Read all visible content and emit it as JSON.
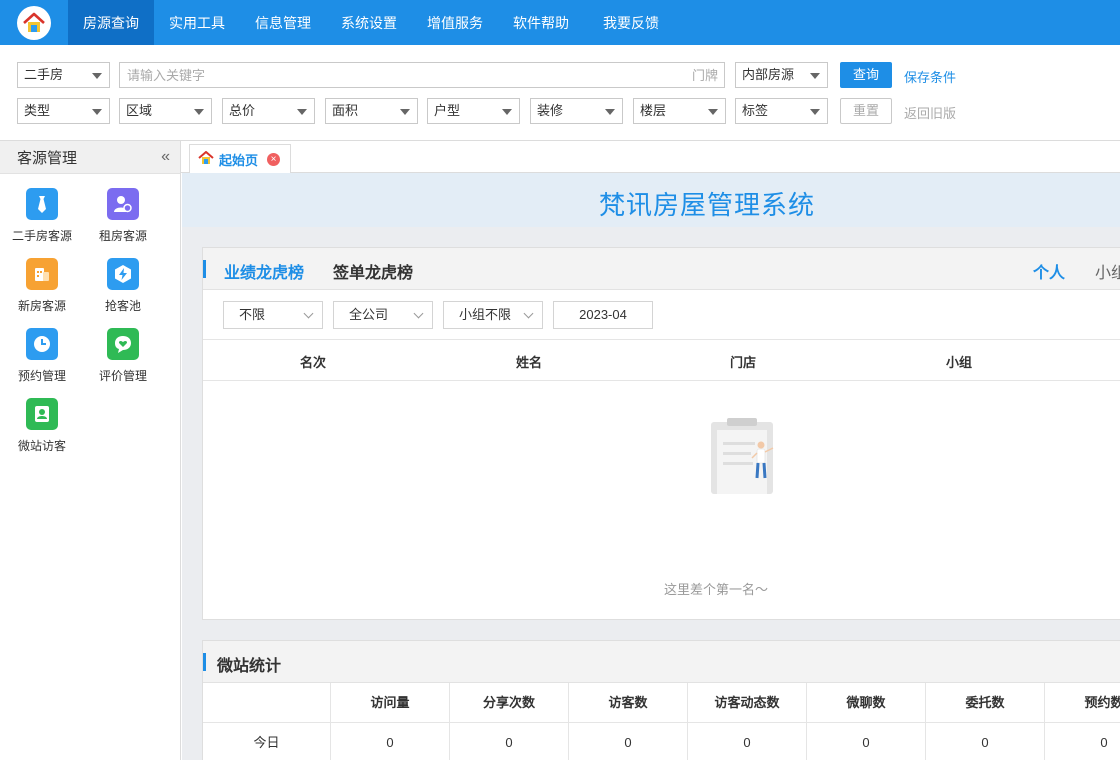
{
  "nav": {
    "items": [
      "房源查询",
      "实用工具",
      "信息管理",
      "系统设置",
      "增值服务",
      "软件帮助",
      "我要反馈"
    ],
    "active_index": 0
  },
  "search": {
    "type_value": "二手房",
    "keyword_placeholder": "请输入关键字",
    "door_placeholder": "门牌",
    "scope_value": "内部房源",
    "query_label": "查询",
    "save_label": "保存条件",
    "reset_label": "重置",
    "old_version_label": "返回旧版",
    "filters": [
      "类型",
      "区域",
      "总价",
      "面积",
      "户型",
      "装修",
      "楼层",
      "标签"
    ]
  },
  "sidebar": {
    "title": "客源管理",
    "items": [
      {
        "label": "二手房客源",
        "icon": "tie-icon",
        "color": "#2d9cf0"
      },
      {
        "label": "租房客源",
        "icon": "users-icon",
        "color": "#7b6cf0"
      },
      {
        "label": "新房客源",
        "icon": "building-icon",
        "color": "#f7a233"
      },
      {
        "label": "抢客池",
        "icon": "lightning-icon",
        "color": "#2d9cf0"
      },
      {
        "label": "预约管理",
        "icon": "clock-icon",
        "color": "#2d9cf0"
      },
      {
        "label": "评价管理",
        "icon": "heart-chat-icon",
        "color": "#2fba55"
      },
      {
        "label": "微站访客",
        "icon": "person-icon",
        "color": "#2fba55"
      }
    ]
  },
  "tabs": [
    {
      "label": "起始页"
    }
  ],
  "banner": {
    "title": "梵讯房屋管理系统"
  },
  "ranking": {
    "tabs": [
      "业绩龙虎榜",
      "签单龙虎榜"
    ],
    "scope_tabs": [
      "个人",
      "小组"
    ],
    "filters": [
      "不限",
      "全公司",
      "小组不限"
    ],
    "date": "2023-04",
    "columns": [
      "名次",
      "姓名",
      "门店",
      "小组"
    ],
    "empty_text": "这里差个第一名～"
  },
  "weizhan": {
    "title": "微站统计",
    "columns": [
      "",
      "访问量",
      "分享次数",
      "访客数",
      "访客动态数",
      "微聊数",
      "委托数",
      "预约数"
    ],
    "rows": [
      {
        "label": "今日",
        "values": [
          "0",
          "0",
          "0",
          "0",
          "0",
          "0",
          "0"
        ]
      }
    ]
  },
  "colors": {
    "primary": "#1e8ee6",
    "nav_active": "#0f6fc6"
  }
}
